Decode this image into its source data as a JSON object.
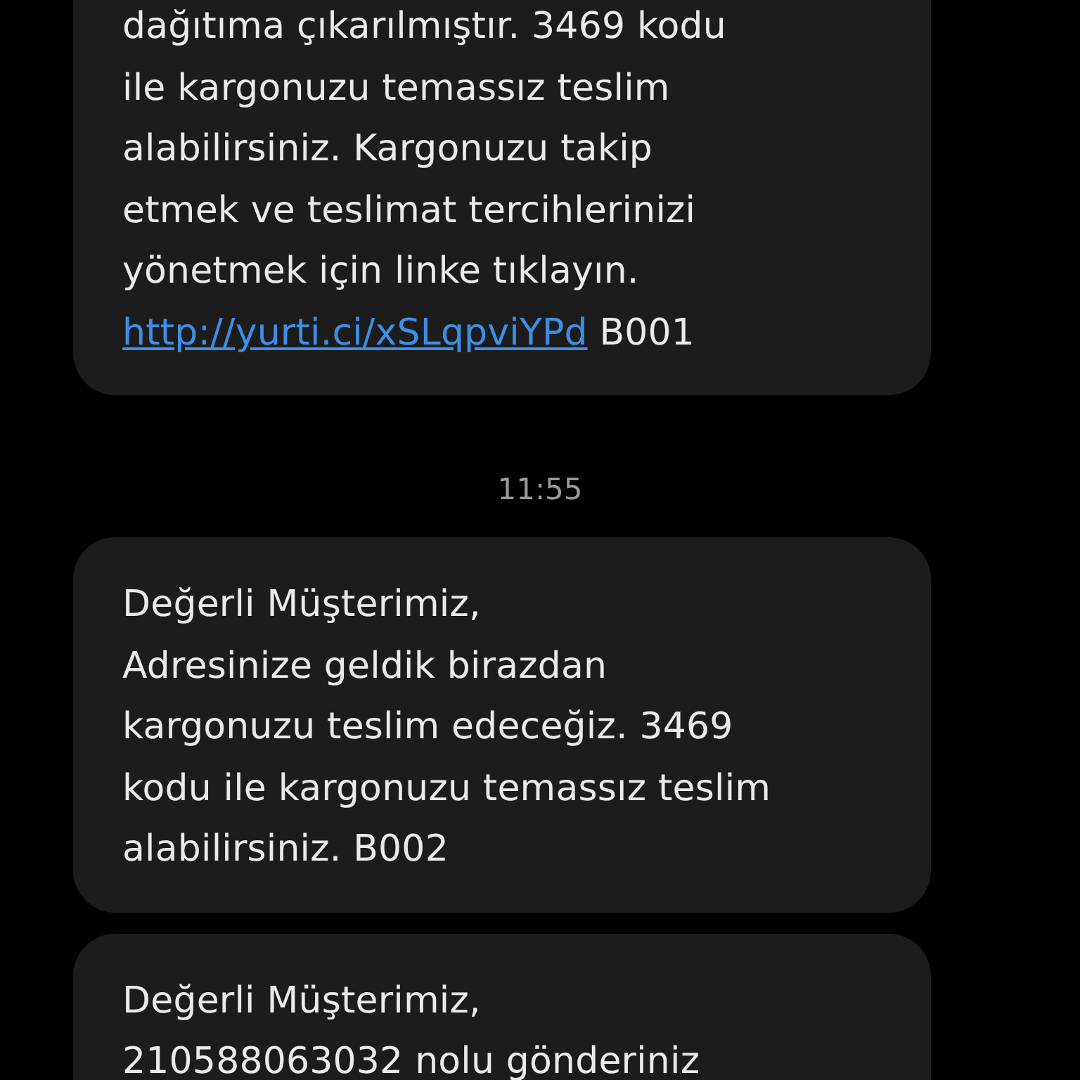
{
  "messages": [
    {
      "text": "dağıtıma çıkarılmıştır. 3469 kodu\nile kargonuzu temassız teslim\nalabilirsiniz. Kargonuzu takip\netmek ve teslimat tercihlerinizi\nyönetmek için linke tıklayın.\n",
      "link": "http://yurti.ci/xSLqpviYPd",
      "tail": " B001"
    },
    {
      "time": "11:55"
    },
    {
      "text": "Değerli Müşterimiz,\nAdresinize geldik birazdan\nkargonuzu teslim edeceğiz. 3469\nkodu ile kargonuzu temassız teslim\nalabilirsiniz. B002"
    },
    {
      "text": "Değerli Müşterimiz,\n210588063032 nolu gönderiniz"
    }
  ]
}
